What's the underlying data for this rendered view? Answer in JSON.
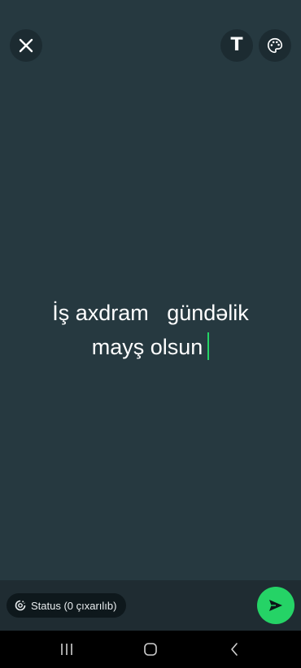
{
  "icons": {
    "close": "close-icon",
    "text_style": "text-style-icon",
    "palette": "palette-icon",
    "status_privacy": "status-privacy-icon",
    "send": "send-icon",
    "recents": "recents-icon",
    "home": "home-icon",
    "back": "back-icon"
  },
  "toolbar": {
    "text_button_label": "T"
  },
  "status": {
    "line1": "İş axdram   gündəlik",
    "line2": "mayş olsun"
  },
  "audience": {
    "label": "Status (0 çıxarılıb)"
  },
  "colors": {
    "background": "#263940",
    "accent": "#25d366",
    "bottom_bar": "#1f2c32"
  }
}
